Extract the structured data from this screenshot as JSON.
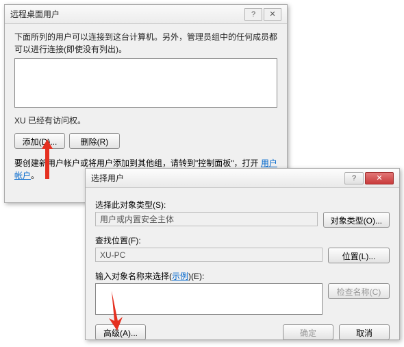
{
  "dialog1": {
    "title": "远程桌面用户",
    "description": "下面所列的用户可以连接到这台计算机。另外，管理员组中的任何成员都可以进行连接(即使没有列出)。",
    "access_line": "XU 已经有访问权。",
    "add_button": "添加(D)...",
    "remove_button": "删除(R)",
    "instruction_prefix": "要创建新用户帐户或将用户添加到其他组，请转到\"控制面板\"，打开 ",
    "instruction_link": "用户帐户",
    "instruction_suffix": "。"
  },
  "dialog2": {
    "title": "选择用户",
    "object_type_label": "选择此对象类型(S):",
    "object_type_value": "用户或内置安全主体",
    "object_type_button": "对象类型(O)...",
    "location_label": "查找位置(F):",
    "location_value": "XU-PC",
    "location_button": "位置(L)...",
    "names_label_a": "输入对象名称来选择(",
    "names_label_link": "示例",
    "names_label_b": ")(E):",
    "check_names_button": "检查名称(C)",
    "advanced_button": "高级(A)...",
    "ok_button": "确定",
    "cancel_button": "取消",
    "names_value": ""
  }
}
